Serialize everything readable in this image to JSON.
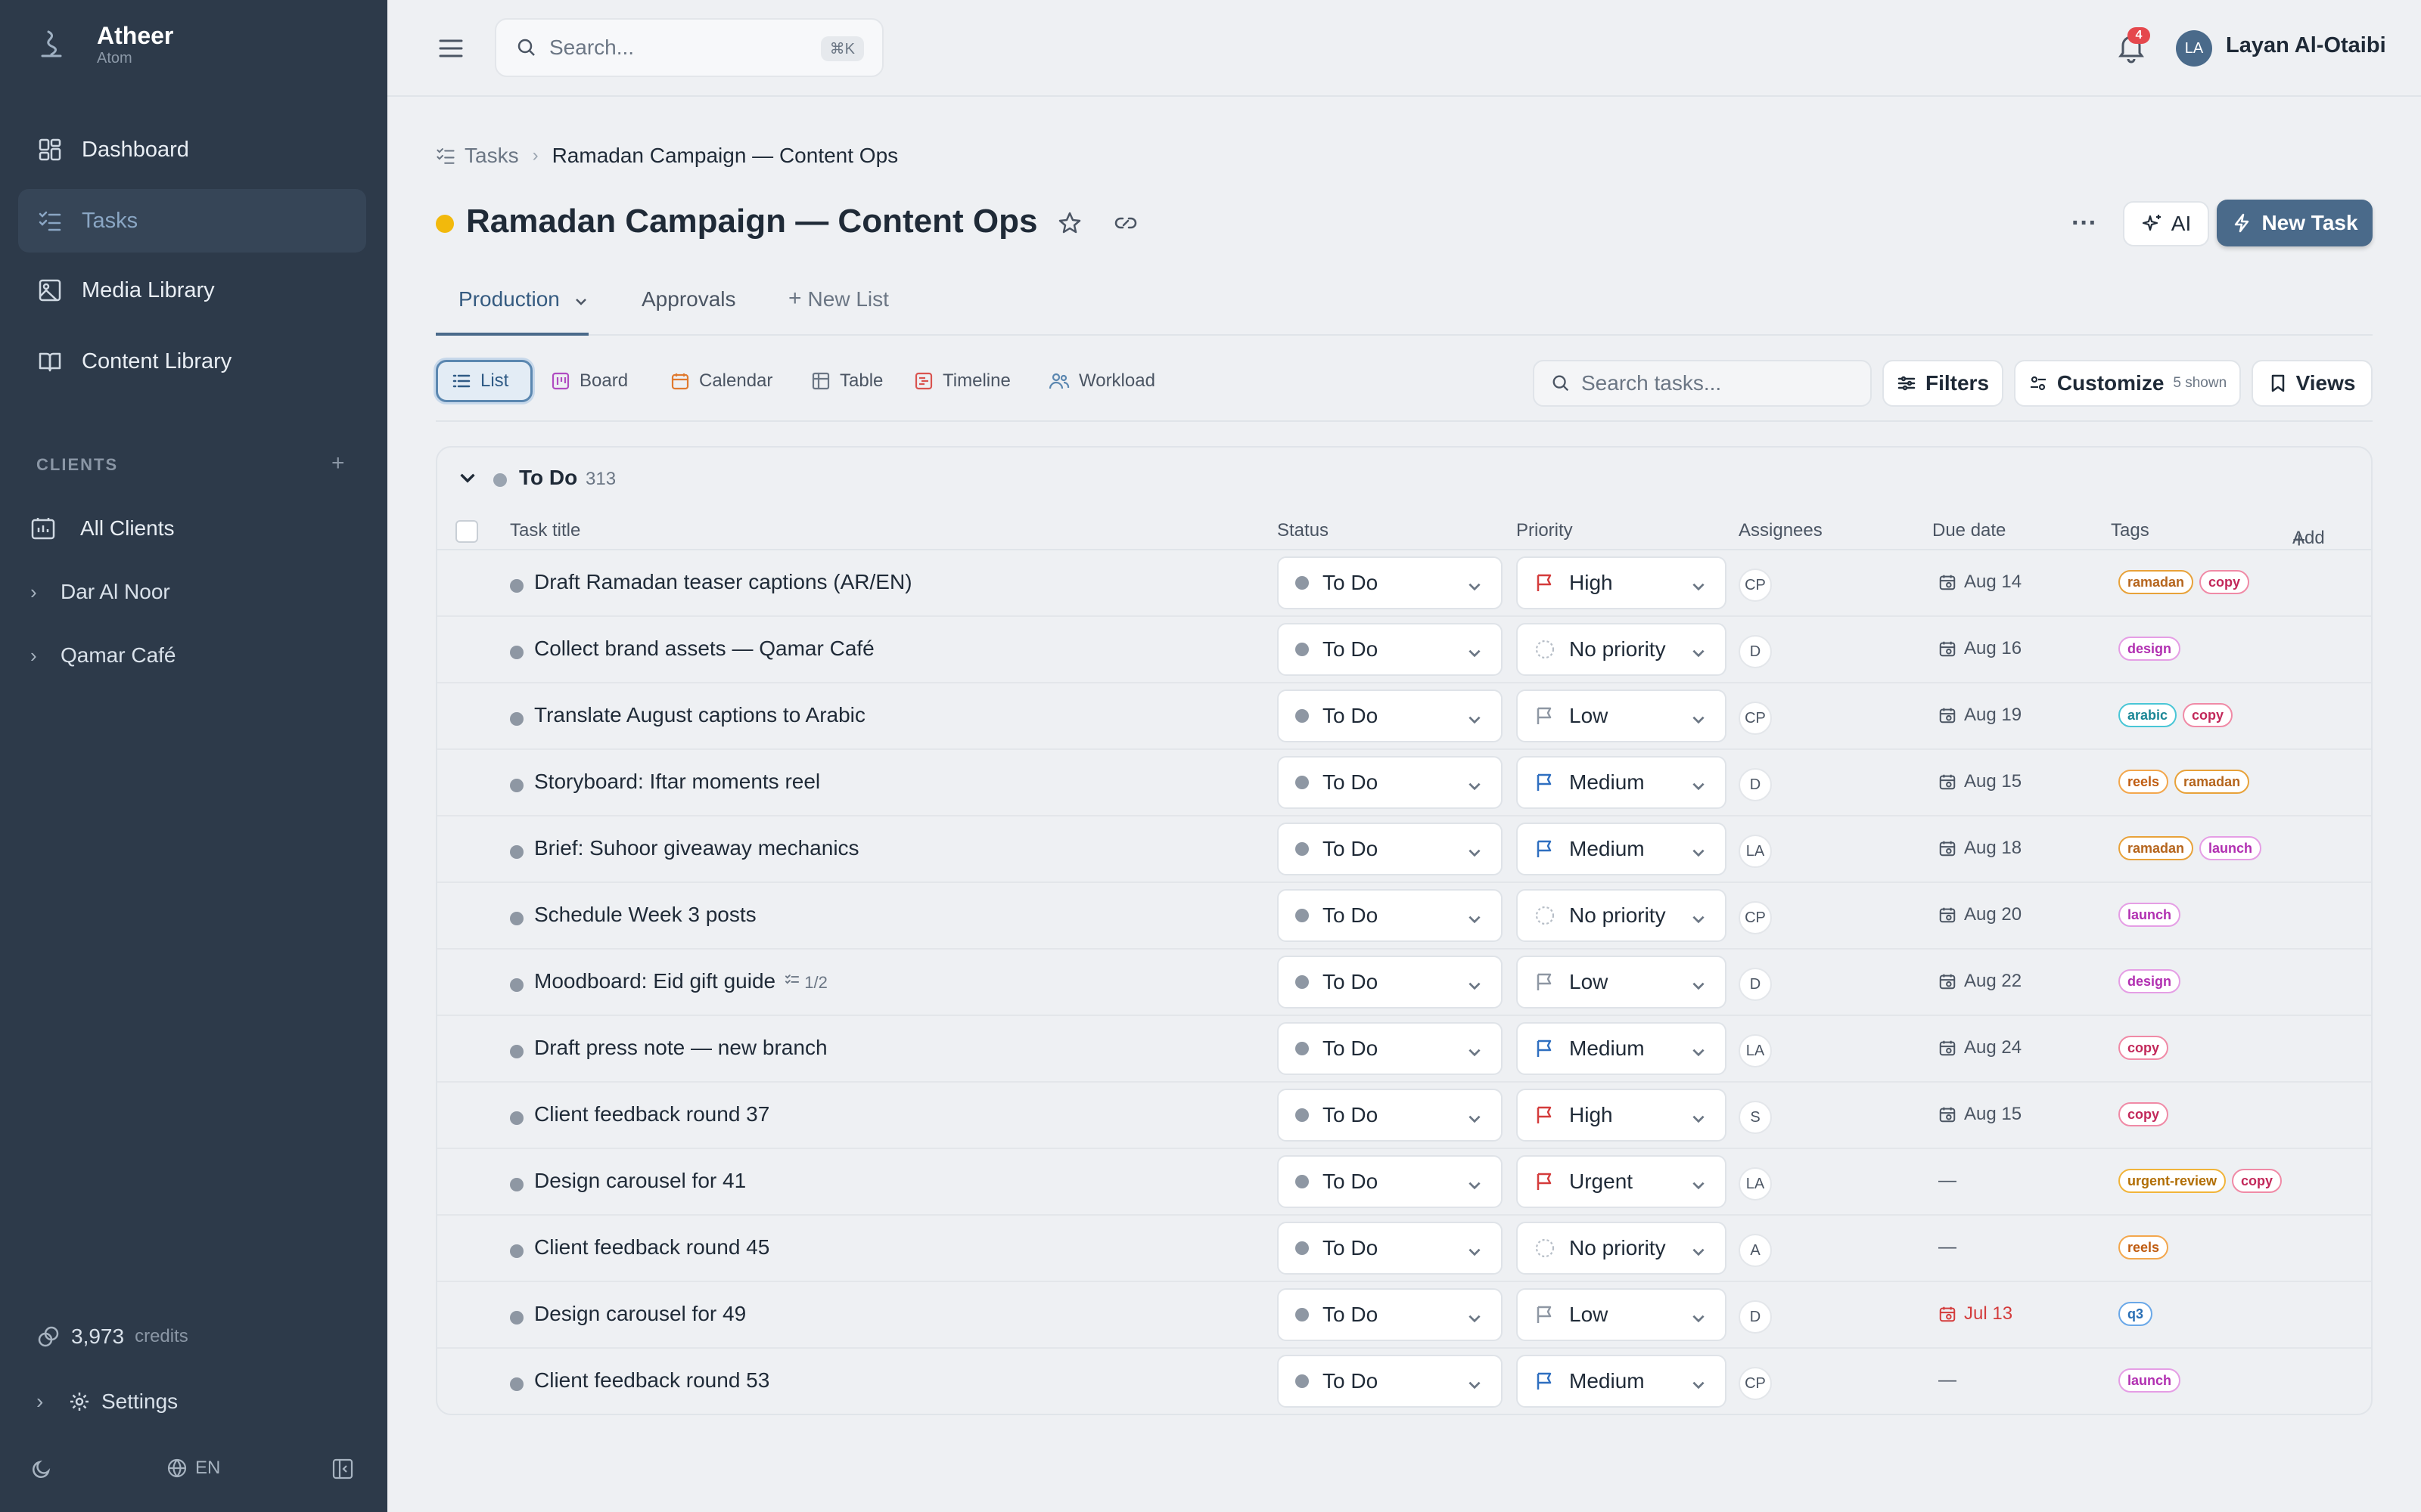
{
  "app": {
    "name": "Atheer",
    "workspace": "Atom"
  },
  "sidebar": {
    "nav": [
      {
        "label": "Dashboard",
        "icon": "dashboard-icon",
        "active": false
      },
      {
        "label": "Tasks",
        "icon": "tasks-icon",
        "active": true
      },
      {
        "label": "Media Library",
        "icon": "image-icon",
        "active": false
      },
      {
        "label": "Content Library",
        "icon": "book-icon",
        "active": false
      }
    ],
    "clients_label": "CLIENTS",
    "clients": [
      {
        "label": "All Clients",
        "icon": "clients-icon"
      },
      {
        "label": "Dar Al Noor"
      },
      {
        "label": "Qamar Café"
      }
    ],
    "credits_value": "3,973",
    "credits_label": "credits",
    "settings_label": "Settings",
    "language": "EN"
  },
  "topbar": {
    "search_placeholder": "Search...",
    "search_shortcut": "⌘K",
    "notification_count": "4",
    "user_initials": "LA",
    "user_name": "Layan Al-Otaibi"
  },
  "breadcrumb": {
    "root": "Tasks",
    "current": "Ramadan Campaign — Content Ops"
  },
  "page": {
    "title": "Ramadan Campaign — Content Ops",
    "status_color": "#f2b90c",
    "ai_label": "AI",
    "new_task_label": "New Task"
  },
  "tabs": [
    {
      "label": "Production",
      "active": true
    },
    {
      "label": "Approvals",
      "active": false
    }
  ],
  "new_list_label": "New List",
  "views": [
    {
      "label": "List",
      "active": true
    },
    {
      "label": "Board"
    },
    {
      "label": "Calendar"
    },
    {
      "label": "Table"
    },
    {
      "label": "Timeline"
    },
    {
      "label": "Workload"
    }
  ],
  "toolbar": {
    "search_placeholder": "Search tasks...",
    "filters_label": "Filters",
    "customize_label": "Customize",
    "customize_hint": "5 shown",
    "views_label": "Views"
  },
  "group": {
    "name": "To Do",
    "count": "313"
  },
  "columns": {
    "title": "Task title",
    "status": "Status",
    "priority": "Priority",
    "assignees": "Assignees",
    "due": "Due date",
    "tags": "Tags",
    "add": "Add"
  },
  "tag_colors": {
    "ramadan": {
      "border": "#e8a23a",
      "text": "#b5651d"
    },
    "copy": {
      "border": "#f08aa6",
      "text": "#c2285a"
    },
    "design": {
      "border": "#e59ee5",
      "text": "#b12fb1"
    },
    "arabic": {
      "border": "#49c6d6",
      "text": "#1b8796"
    },
    "reels": {
      "border": "#f3a74d",
      "text": "#c05d12"
    },
    "launch": {
      "border": "#e59ee5",
      "text": "#b12fb1"
    },
    "urgent-review": {
      "border": "#f1b43a",
      "text": "#b16e05"
    },
    "q3": {
      "border": "#6aa8e8",
      "text": "#2a6fb5"
    }
  },
  "priority_colors": {
    "High": "#d43c3c",
    "Urgent": "#d43c3c",
    "Medium": "#2f6fc0",
    "Low": "#8e97a3",
    "No priority": "#b7bec7"
  },
  "rows": [
    {
      "title": "Draft Ramadan teaser captions (AR/EN)",
      "subtasks": "",
      "status": "To Do",
      "priority": "High",
      "assignee": "CP",
      "due": "Aug 14",
      "overdue": false,
      "tags": [
        "ramadan",
        "copy"
      ]
    },
    {
      "title": "Collect brand assets — Qamar Café",
      "subtasks": "",
      "status": "To Do",
      "priority": "No priority",
      "assignee": "D",
      "due": "Aug 16",
      "overdue": false,
      "tags": [
        "design"
      ]
    },
    {
      "title": "Translate August captions to Arabic",
      "subtasks": "",
      "status": "To Do",
      "priority": "Low",
      "assignee": "CP",
      "due": "Aug 19",
      "overdue": false,
      "tags": [
        "arabic",
        "copy"
      ]
    },
    {
      "title": "Storyboard: Iftar moments reel",
      "subtasks": "",
      "status": "To Do",
      "priority": "Medium",
      "assignee": "D",
      "due": "Aug 15",
      "overdue": false,
      "tags": [
        "reels",
        "ramadan"
      ]
    },
    {
      "title": "Brief: Suhoor giveaway mechanics",
      "subtasks": "",
      "status": "To Do",
      "priority": "Medium",
      "assignee": "LA",
      "due": "Aug 18",
      "overdue": false,
      "tags": [
        "ramadan",
        "launch"
      ]
    },
    {
      "title": "Schedule Week 3 posts",
      "subtasks": "",
      "status": "To Do",
      "priority": "No priority",
      "assignee": "CP",
      "due": "Aug 20",
      "overdue": false,
      "tags": [
        "launch"
      ]
    },
    {
      "title": "Moodboard: Eid gift guide",
      "subtasks": "1/2",
      "status": "To Do",
      "priority": "Low",
      "assignee": "D",
      "due": "Aug 22",
      "overdue": false,
      "tags": [
        "design"
      ]
    },
    {
      "title": "Draft press note — new branch",
      "subtasks": "",
      "status": "To Do",
      "priority": "Medium",
      "assignee": "LA",
      "due": "Aug 24",
      "overdue": false,
      "tags": [
        "copy"
      ]
    },
    {
      "title": "Client feedback round 37",
      "subtasks": "",
      "status": "To Do",
      "priority": "High",
      "assignee": "S",
      "due": "Aug 15",
      "overdue": false,
      "tags": [
        "copy"
      ]
    },
    {
      "title": "Design carousel for 41",
      "subtasks": "",
      "status": "To Do",
      "priority": "Urgent",
      "assignee": "LA",
      "due": "—",
      "overdue": false,
      "tags": [
        "urgent-review",
        "copy"
      ]
    },
    {
      "title": "Client feedback round 45",
      "subtasks": "",
      "status": "To Do",
      "priority": "No priority",
      "assignee": "A",
      "due": "—",
      "overdue": false,
      "tags": [
        "reels"
      ]
    },
    {
      "title": "Design carousel for 49",
      "subtasks": "",
      "status": "To Do",
      "priority": "Low",
      "assignee": "D",
      "due": "Jul 13",
      "overdue": true,
      "tags": [
        "q3"
      ]
    },
    {
      "title": "Client feedback round 53",
      "subtasks": "",
      "status": "To Do",
      "priority": "Medium",
      "assignee": "CP",
      "due": "—",
      "overdue": false,
      "tags": [
        "launch"
      ]
    }
  ]
}
